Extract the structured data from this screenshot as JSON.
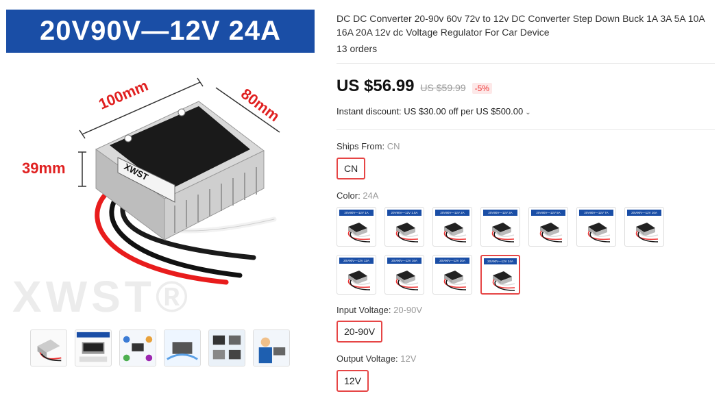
{
  "gallery": {
    "banner": "20V90V—12V  24A",
    "dim_length": "100mm",
    "dim_width": "80mm",
    "dim_height": "39mm",
    "brand": "XWST",
    "watermark": "XWST®",
    "thumbnails": [
      "thumb-1",
      "thumb-2",
      "thumb-3",
      "thumb-4",
      "thumb-5",
      "thumb-6"
    ]
  },
  "product": {
    "title": "DC DC Converter 20-90v 60v 72v to 12v DC Converter Step Down Buck 1A 3A 5A 10A 16A 20A 12v dc Voltage Regulator For Car Device",
    "orders": "13 orders"
  },
  "price": {
    "current": "US $56.99",
    "original": "US $59.99",
    "discount": "-5%"
  },
  "instant_discount": "Instant discount: US $30.00 off per US $500.00",
  "ships_from": {
    "label": "Ships From:",
    "value": "CN",
    "selected": "CN"
  },
  "color": {
    "label": "Color:",
    "value": "24A",
    "options": [
      {
        "head": "20V90V—12V 1A"
      },
      {
        "head": "20V90V—12V 1.5A"
      },
      {
        "head": "20V90V—12V 2A"
      },
      {
        "head": "20V90V—12V 3A"
      },
      {
        "head": "20V90V—12V 5A"
      },
      {
        "head": "20V90V—12V 7A"
      },
      {
        "head": "20V90V—12V 10A"
      },
      {
        "head": "20V90V—12V 12A"
      },
      {
        "head": "20V90V—12V 16A"
      },
      {
        "head": "20V90V—12V 20A"
      },
      {
        "head": "20V90V—12V 24A"
      }
    ],
    "selected_index": 10
  },
  "input_voltage": {
    "label": "Input Voltage:",
    "value": "20-90V",
    "selected": "20-90V"
  },
  "output_voltage": {
    "label": "Output Voltage:",
    "value": "12V",
    "selected": "12V"
  },
  "colors": {
    "accent_red": "#e64545",
    "banner_blue": "#1a4ea6"
  }
}
